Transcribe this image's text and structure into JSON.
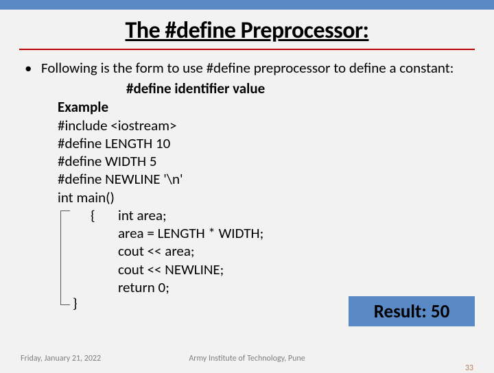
{
  "title": "The #define Preprocessor:",
  "bullet": "•",
  "intro": "Following is the form to use #define preprocessor to define a constant:",
  "syntax": "#define identifier value",
  "example": {
    "label": "Example",
    "lines": [
      "#include <iostream>",
      "#define LENGTH 10",
      "#define WIDTH 5",
      "#define NEWLINE '\\n'",
      "int main()"
    ],
    "brace_open": "{",
    "brace_close": "}",
    "body": [
      "int area;",
      "area = LENGTH * WIDTH;",
      "cout << area;",
      "cout << NEWLINE;",
      "return 0;"
    ]
  },
  "result": "Result: 50",
  "footer": {
    "date": "Friday, January 21, 2022",
    "institution": "Army Institute of Technology, Pune",
    "page": "33"
  }
}
